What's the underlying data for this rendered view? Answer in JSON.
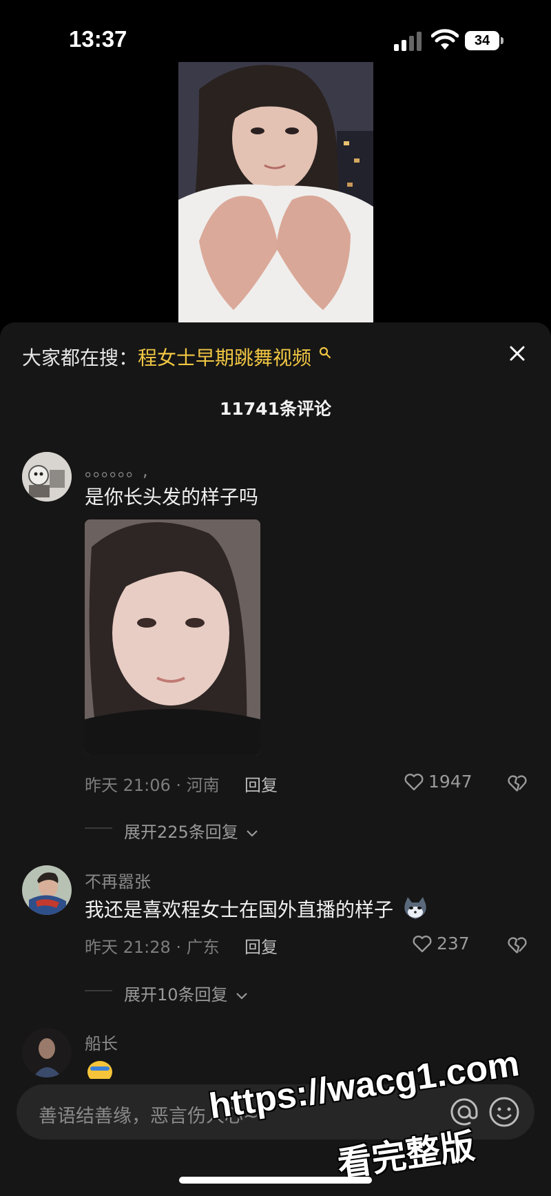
{
  "status_bar": {
    "time": "13:37",
    "battery": "34"
  },
  "panel": {
    "search_prefix": "大家都在搜：",
    "search_term": "程女士早期跳舞视频",
    "comment_count": "11741条评论"
  },
  "comments": [
    {
      "username": "。。。。。。,",
      "text": "是你长头发的样子吗",
      "meta": "昨天 21:06 · 河南",
      "reply_label": "回复",
      "likes": "1947",
      "expand": "展开225条回复"
    },
    {
      "username": "不再嚣张",
      "text": "我还是喜欢程女士在国外直播的样子",
      "meta": "昨天 21:28 · 广东",
      "reply_label": "回复",
      "likes": "237",
      "expand": "展开10条回复"
    },
    {
      "username": "船长",
      "text": ""
    }
  ],
  "input": {
    "placeholder": "善语结善缘，恶言伤人心~"
  },
  "watermark": {
    "line1": "https://wacg1.com",
    "line2": "看完整版"
  },
  "colors": {
    "accent": "#f2c744",
    "panel_bg": "#161616",
    "input_bg": "#262626"
  },
  "icons": [
    "signal-icon",
    "wifi-icon",
    "battery-icon",
    "search-icon",
    "close-icon",
    "heart-icon",
    "broken-heart-icon",
    "chevron-down-icon",
    "at-icon",
    "emoji-icon",
    "cat-emoji-icon",
    "face-emoji-icon"
  ]
}
